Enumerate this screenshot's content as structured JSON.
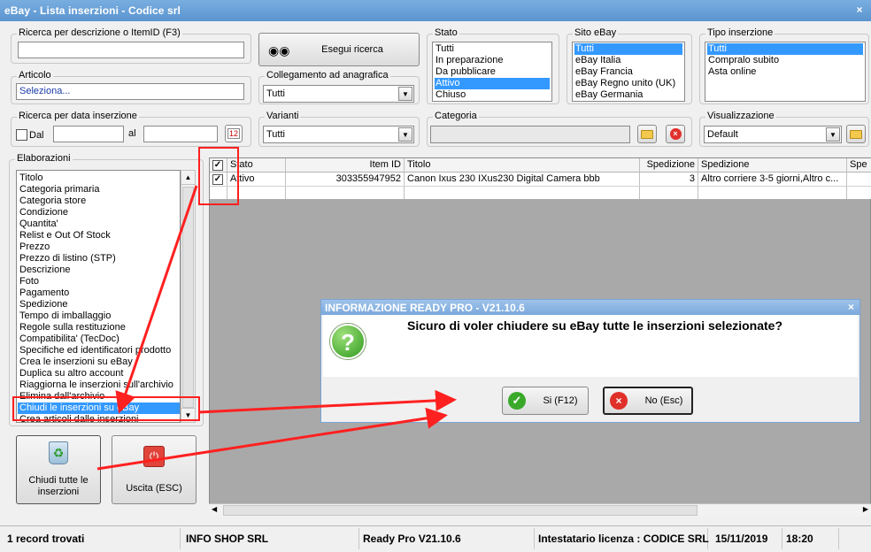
{
  "window": {
    "title": "eBay - Lista inserzioni - Codice srl",
    "close": "×"
  },
  "search": {
    "label": "Ricerca per descrizione o ItemID (F3)",
    "value": "",
    "button": "Esegui ricerca"
  },
  "articolo": {
    "label": "Articolo",
    "value": "Seleziona..."
  },
  "collegamento": {
    "label": "Collegamento ad anagrafica",
    "value": "Tutti"
  },
  "data_ins": {
    "label": "Ricerca per data inserzione",
    "dal": "Dal",
    "al": "al"
  },
  "varianti": {
    "label": "Varianti",
    "value": "Tutti"
  },
  "categoria": {
    "label": "Categoria",
    "value": ""
  },
  "visualizzazione": {
    "label": "Visualizzazione",
    "value": "Default"
  },
  "stato": {
    "label": "Stato",
    "items": [
      "Tutti",
      "In preparazione",
      "Da pubblicare",
      "Attivo",
      "Chiuso"
    ],
    "selected": 3
  },
  "sito": {
    "label": "Sito eBay",
    "items": [
      "Tutti",
      "eBay Italia",
      "eBay Francia",
      "eBay Regno unito (UK)",
      "eBay Germania"
    ],
    "selected": 0
  },
  "tipo": {
    "label": "Tipo inserzione",
    "items": [
      "Tutti",
      "Compralo subito",
      "Asta online"
    ],
    "selected": 0
  },
  "elaborazioni": {
    "label": "Elaborazioni",
    "items": [
      "Titolo",
      "Categoria primaria",
      "Categoria store",
      "Condizione",
      "Quantita'",
      "Relist e Out Of Stock",
      "Prezzo",
      "Prezzo di listino (STP)",
      "Descrizione",
      "Foto",
      "Pagamento",
      "Spedizione",
      "Tempo di imballaggio",
      "Regole sulla restituzione",
      "Compatibilita' (TecDoc)",
      "Specifiche ed identificatori prodotto",
      "Crea le inserzioni su eBay",
      "Duplica su altro account",
      "Riaggiorna le inserzioni sull'archivio",
      "Elimina dall'archivio",
      "Chiudi le inserzioni su eBay",
      "Crea articoli dalle inserzioni"
    ],
    "selected": 20
  },
  "actions": {
    "close_all": "Chiudi tutte le inserzioni",
    "exit": "Uscita (ESC)"
  },
  "grid": {
    "headers": [
      "Stato",
      "Item ID",
      "Titolo",
      "Spedizione",
      "Spedizione",
      "Spe"
    ],
    "rows": [
      {
        "stato": "Attivo",
        "item_id": "303355947952",
        "titolo": "Canon Ixus 230 IXus230 Digital Camera bbb",
        "spedizione_n": "3",
        "spedizione": "Altro corriere 3-5 giorni,Altro c..."
      }
    ]
  },
  "dialog": {
    "title": "INFORMAZIONE READY PRO - V21.10.6",
    "message": "Sicuro di voler chiudere su eBay tutte le inserzioni selezionate?",
    "yes": "Si (F12)",
    "no": "No (Esc)",
    "close": "×"
  },
  "status": {
    "records": "1 record trovati",
    "company": "INFO SHOP SRL",
    "version": "Ready Pro V21.10.6",
    "license": "Intestatario licenza : CODICE SRL",
    "date": "15/11/2019",
    "time": "18:20"
  },
  "colors": {
    "title_bar": "#5b94cf",
    "selection": "#3399ff",
    "annotation": "#ff2020"
  }
}
